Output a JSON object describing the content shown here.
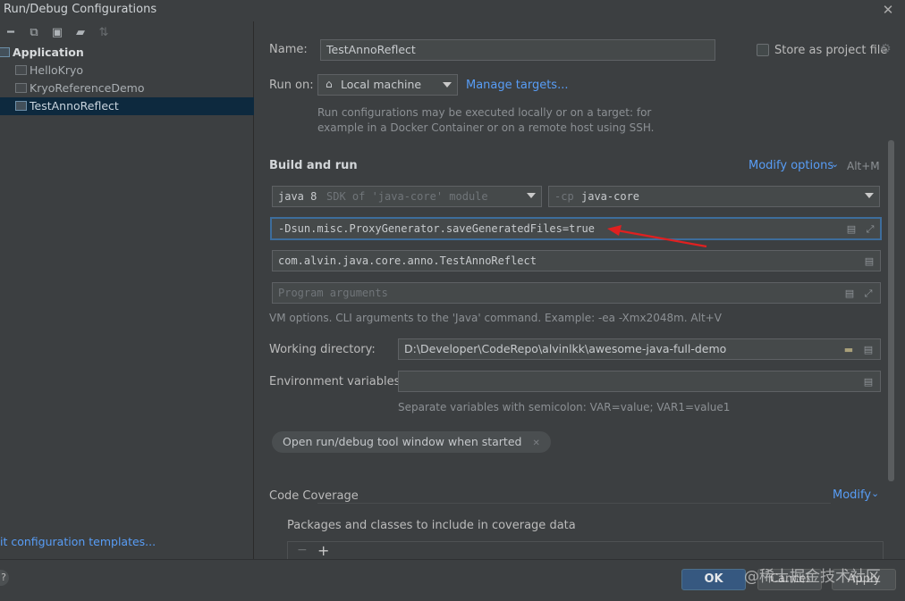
{
  "window": {
    "title": "Run/Debug Configurations"
  },
  "toolbar": {
    "icons": [
      "minus-icon",
      "copy-icon",
      "save-icon",
      "new-folder-icon",
      "sort-icon"
    ]
  },
  "tree": {
    "application_label": "Application",
    "items": [
      "HelloKryo",
      "KryoReferenceDemo",
      "TestAnnoReflect"
    ],
    "selected": "TestAnnoReflect"
  },
  "templates_link": "it configuration templates...",
  "form": {
    "name_label": "Name:",
    "name_value": "TestAnnoReflect",
    "store_label": "Store as project file",
    "run_on_label": "Run on:",
    "run_on_value": "Local machine",
    "manage_targets": "Manage targets...",
    "run_on_hint_1": "Run configurations may be executed locally or on a target: for",
    "run_on_hint_2": "example in a Docker Container or on a remote host using SSH.",
    "build_run_title": "Build and run",
    "modify_options": "Modify options",
    "modify_shortcut": "Alt+M",
    "jdk_version": "java 8",
    "jdk_desc": "SDK of 'java-core' module",
    "cp_flag": "-cp",
    "cp_value": "java-core",
    "vm_options": "-Dsun.misc.ProxyGenerator.saveGeneratedFiles=true",
    "main_class": "com.alvin.java.core.anno.TestAnnoReflect",
    "program_args_placeholder": "Program arguments",
    "vm_hint": "VM options. CLI arguments to the 'Java' command. Example: -ea -Xmx2048m. Alt+V",
    "working_dir_label": "Working directory:",
    "working_dir_value": "D:\\Developer\\CodeRepo\\alvinlkk\\awesome-java-full-demo",
    "env_label": "Environment variables:",
    "env_value": "",
    "env_hint": "Separate variables with semicolon: VAR=value; VAR1=value1",
    "open_tool_window": "Open run/debug tool window when started",
    "code_coverage_title": "Code Coverage",
    "modify": "Modify",
    "coverage_packages_label": "Packages and classes to include in coverage data"
  },
  "buttons": {
    "ok": "OK",
    "cancel": "Cancel",
    "apply": "Apply",
    "help": "?"
  },
  "watermark": "@稀土掘金技术社区",
  "colors": {
    "accent_link": "#589df6",
    "selection": "#0d293e",
    "focus_border": "#3d6d9c",
    "arrow": "#e02020",
    "ok_button": "#365880"
  }
}
